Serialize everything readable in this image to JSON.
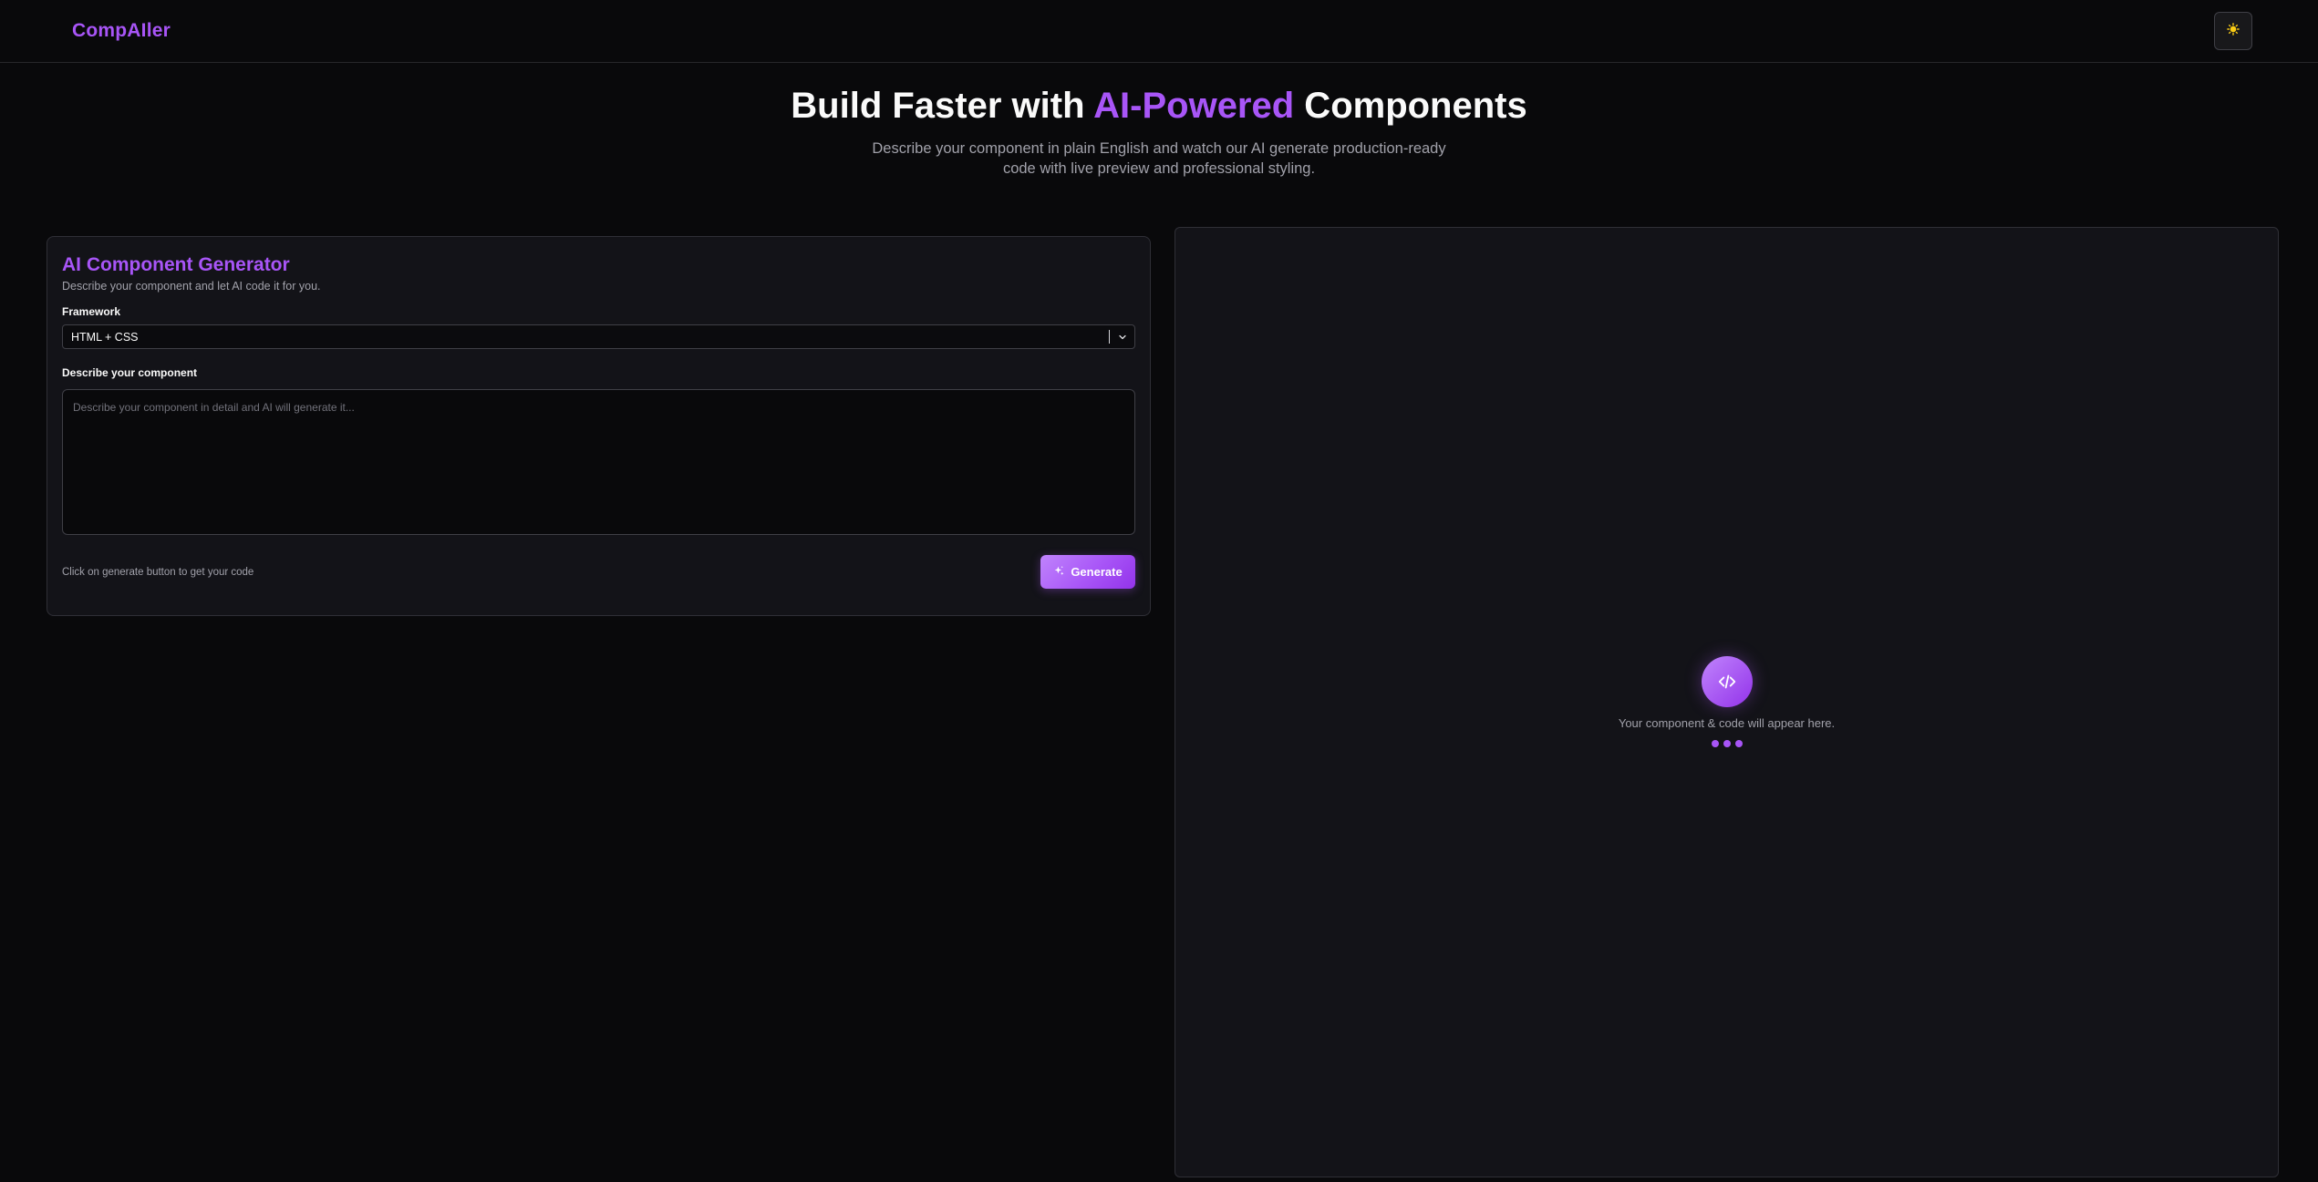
{
  "app": {
    "brand": "CompAIler",
    "theme_toggle_icon": "sun-icon"
  },
  "hero": {
    "title_prefix": "Build Faster with ",
    "title_accent": "AI-Powered",
    "title_suffix": " Components",
    "subtitle": "Describe your component in plain English and watch our AI generate production-ready code with live preview and professional styling."
  },
  "generator": {
    "title": "AI Component Generator",
    "subtitle": "Describe your component and let AI code it for you.",
    "framework_label": "Framework",
    "framework_value": "HTML + CSS",
    "description_label": "Describe your component",
    "description_placeholder": "Describe your component in detail and AI will generate it...",
    "description_value": "",
    "hint": "Click on generate button to get your code",
    "generate_label": "Generate"
  },
  "preview": {
    "placeholder_text": "Your component & code will appear here.",
    "icon": "code-icon"
  },
  "colors": {
    "accent": "#a855f7",
    "background": "#09090b",
    "card": "#131318",
    "sun": "#facc15"
  }
}
